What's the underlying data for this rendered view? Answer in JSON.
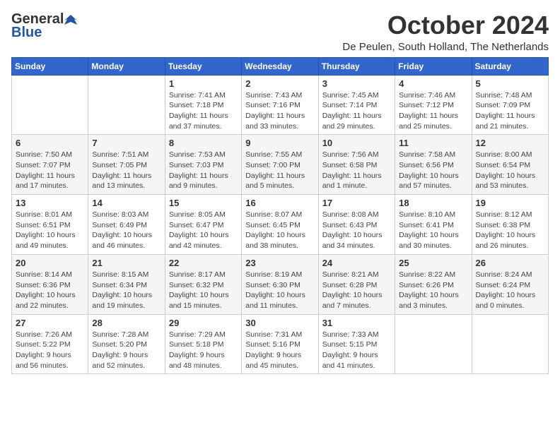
{
  "header": {
    "logo_general": "General",
    "logo_blue": "Blue",
    "month": "October 2024",
    "location": "De Peulen, South Holland, The Netherlands"
  },
  "weekdays": [
    "Sunday",
    "Monday",
    "Tuesday",
    "Wednesday",
    "Thursday",
    "Friday",
    "Saturday"
  ],
  "weeks": [
    [
      {
        "day": "",
        "text": ""
      },
      {
        "day": "",
        "text": ""
      },
      {
        "day": "1",
        "text": "Sunrise: 7:41 AM\nSunset: 7:18 PM\nDaylight: 11 hours and 37 minutes."
      },
      {
        "day": "2",
        "text": "Sunrise: 7:43 AM\nSunset: 7:16 PM\nDaylight: 11 hours and 33 minutes."
      },
      {
        "day": "3",
        "text": "Sunrise: 7:45 AM\nSunset: 7:14 PM\nDaylight: 11 hours and 29 minutes."
      },
      {
        "day": "4",
        "text": "Sunrise: 7:46 AM\nSunset: 7:12 PM\nDaylight: 11 hours and 25 minutes."
      },
      {
        "day": "5",
        "text": "Sunrise: 7:48 AM\nSunset: 7:09 PM\nDaylight: 11 hours and 21 minutes."
      }
    ],
    [
      {
        "day": "6",
        "text": "Sunrise: 7:50 AM\nSunset: 7:07 PM\nDaylight: 11 hours and 17 minutes."
      },
      {
        "day": "7",
        "text": "Sunrise: 7:51 AM\nSunset: 7:05 PM\nDaylight: 11 hours and 13 minutes."
      },
      {
        "day": "8",
        "text": "Sunrise: 7:53 AM\nSunset: 7:03 PM\nDaylight: 11 hours and 9 minutes."
      },
      {
        "day": "9",
        "text": "Sunrise: 7:55 AM\nSunset: 7:00 PM\nDaylight: 11 hours and 5 minutes."
      },
      {
        "day": "10",
        "text": "Sunrise: 7:56 AM\nSunset: 6:58 PM\nDaylight: 11 hours and 1 minute."
      },
      {
        "day": "11",
        "text": "Sunrise: 7:58 AM\nSunset: 6:56 PM\nDaylight: 10 hours and 57 minutes."
      },
      {
        "day": "12",
        "text": "Sunrise: 8:00 AM\nSunset: 6:54 PM\nDaylight: 10 hours and 53 minutes."
      }
    ],
    [
      {
        "day": "13",
        "text": "Sunrise: 8:01 AM\nSunset: 6:51 PM\nDaylight: 10 hours and 49 minutes."
      },
      {
        "day": "14",
        "text": "Sunrise: 8:03 AM\nSunset: 6:49 PM\nDaylight: 10 hours and 46 minutes."
      },
      {
        "day": "15",
        "text": "Sunrise: 8:05 AM\nSunset: 6:47 PM\nDaylight: 10 hours and 42 minutes."
      },
      {
        "day": "16",
        "text": "Sunrise: 8:07 AM\nSunset: 6:45 PM\nDaylight: 10 hours and 38 minutes."
      },
      {
        "day": "17",
        "text": "Sunrise: 8:08 AM\nSunset: 6:43 PM\nDaylight: 10 hours and 34 minutes."
      },
      {
        "day": "18",
        "text": "Sunrise: 8:10 AM\nSunset: 6:41 PM\nDaylight: 10 hours and 30 minutes."
      },
      {
        "day": "19",
        "text": "Sunrise: 8:12 AM\nSunset: 6:38 PM\nDaylight: 10 hours and 26 minutes."
      }
    ],
    [
      {
        "day": "20",
        "text": "Sunrise: 8:14 AM\nSunset: 6:36 PM\nDaylight: 10 hours and 22 minutes."
      },
      {
        "day": "21",
        "text": "Sunrise: 8:15 AM\nSunset: 6:34 PM\nDaylight: 10 hours and 19 minutes."
      },
      {
        "day": "22",
        "text": "Sunrise: 8:17 AM\nSunset: 6:32 PM\nDaylight: 10 hours and 15 minutes."
      },
      {
        "day": "23",
        "text": "Sunrise: 8:19 AM\nSunset: 6:30 PM\nDaylight: 10 hours and 11 minutes."
      },
      {
        "day": "24",
        "text": "Sunrise: 8:21 AM\nSunset: 6:28 PM\nDaylight: 10 hours and 7 minutes."
      },
      {
        "day": "25",
        "text": "Sunrise: 8:22 AM\nSunset: 6:26 PM\nDaylight: 10 hours and 3 minutes."
      },
      {
        "day": "26",
        "text": "Sunrise: 8:24 AM\nSunset: 6:24 PM\nDaylight: 10 hours and 0 minutes."
      }
    ],
    [
      {
        "day": "27",
        "text": "Sunrise: 7:26 AM\nSunset: 5:22 PM\nDaylight: 9 hours and 56 minutes."
      },
      {
        "day": "28",
        "text": "Sunrise: 7:28 AM\nSunset: 5:20 PM\nDaylight: 9 hours and 52 minutes."
      },
      {
        "day": "29",
        "text": "Sunrise: 7:29 AM\nSunset: 5:18 PM\nDaylight: 9 hours and 48 minutes."
      },
      {
        "day": "30",
        "text": "Sunrise: 7:31 AM\nSunset: 5:16 PM\nDaylight: 9 hours and 45 minutes."
      },
      {
        "day": "31",
        "text": "Sunrise: 7:33 AM\nSunset: 5:15 PM\nDaylight: 9 hours and 41 minutes."
      },
      {
        "day": "",
        "text": ""
      },
      {
        "day": "",
        "text": ""
      }
    ]
  ]
}
